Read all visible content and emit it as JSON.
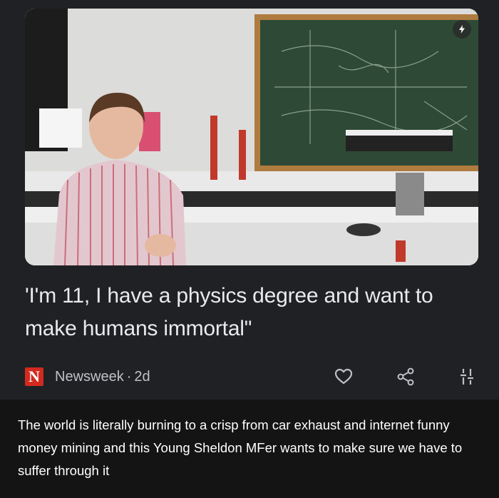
{
  "article": {
    "headline": "'I'm 11, I have a physics degree and want to make humans immortal\"",
    "source_logo_letter": "N",
    "source": "Newsweek",
    "separator": "·",
    "age": "2d",
    "thumbnail_badge_icon": "lightning-icon",
    "actions": [
      "heart-icon",
      "share-icon",
      "tune-icon"
    ]
  },
  "comment": {
    "text": "The world is literally burning to a crisp from car exhaust and internet funny money mining and this Young Sheldon MFer wants to make sure we have to suffer through it"
  },
  "colors": {
    "card_bg": "#202124",
    "page_bg": "#141414",
    "headline": "#e8eaed",
    "meta": "#bdc1c6",
    "logo_red": "#d32a1f"
  }
}
